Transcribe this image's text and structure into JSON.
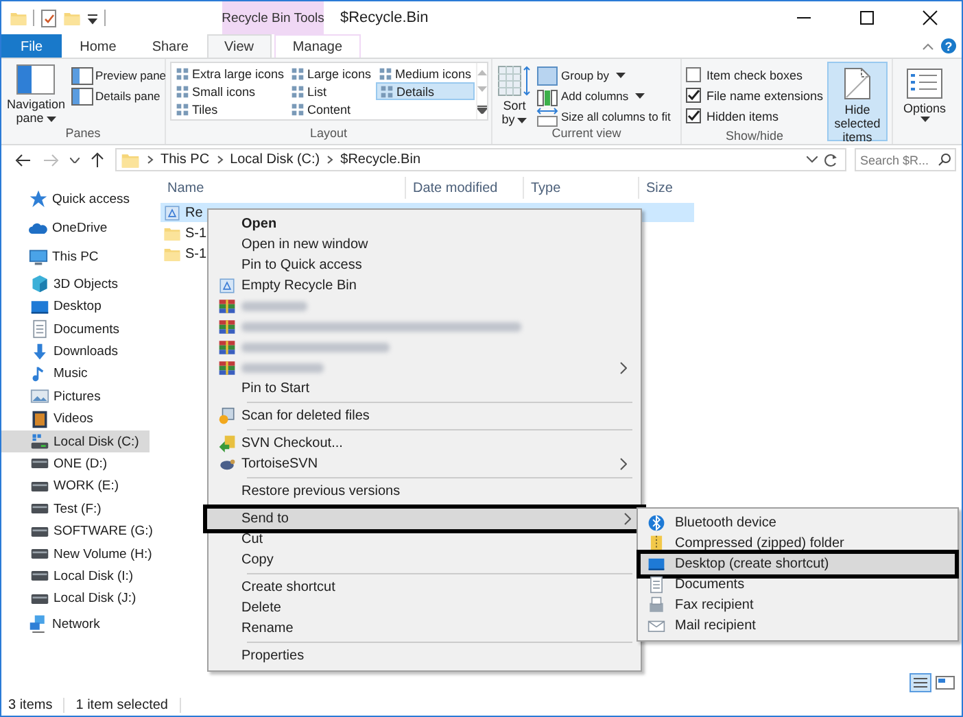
{
  "window": {
    "title": "$Recycle.Bin",
    "context_tab": "Recycle Bin Tools",
    "help_button": "?"
  },
  "tabs": [
    {
      "label": "File",
      "kind": "file",
      "selected": false
    },
    {
      "label": "Home",
      "kind": "tab",
      "selected": false
    },
    {
      "label": "Share",
      "kind": "tab",
      "selected": false
    },
    {
      "label": "View",
      "kind": "tab",
      "selected": true
    },
    {
      "label": "Manage",
      "kind": "context",
      "selected": false
    }
  ],
  "ribbon": {
    "panes": {
      "label": "Panes",
      "navigation_pane": "Navigation pane",
      "items": [
        "Preview pane",
        "Details pane"
      ]
    },
    "layout": {
      "label": "Layout",
      "items": [
        {
          "label": "Extra large icons",
          "selected": false
        },
        {
          "label": "Large icons",
          "selected": false
        },
        {
          "label": "Medium icons",
          "selected": false
        },
        {
          "label": "Small icons",
          "selected": false
        },
        {
          "label": "List",
          "selected": false
        },
        {
          "label": "Details",
          "selected": true
        },
        {
          "label": "Tiles",
          "selected": false
        },
        {
          "label": "Content",
          "selected": false
        }
      ]
    },
    "current_view": {
      "label": "Current view",
      "sort_by": "Sort by",
      "items": [
        "Group by",
        "Add columns",
        "Size all columns to fit"
      ]
    },
    "show_hide": {
      "label": "Show/hide",
      "checkboxes": [
        {
          "label": "Item check boxes",
          "checked": false
        },
        {
          "label": "File name extensions",
          "checked": true
        },
        {
          "label": "Hidden items",
          "checked": true
        }
      ],
      "hide_selected": "Hide selected items"
    },
    "options": {
      "label": "Options"
    }
  },
  "address": {
    "path": [
      "This PC",
      "Local Disk (C:)",
      "$Recycle.Bin"
    ],
    "search_placeholder": "Search $R..."
  },
  "sidebar": {
    "items": [
      {
        "label": "Quick access",
        "kind": "star",
        "selected": false
      },
      {
        "label": "OneDrive",
        "kind": "cloud",
        "selected": false
      },
      {
        "label": "This PC",
        "kind": "pc",
        "selected": false,
        "children": [
          {
            "label": "3D Objects",
            "kind": "cube",
            "selected": false
          },
          {
            "label": "Desktop",
            "kind": "desktop",
            "selected": false
          },
          {
            "label": "Documents",
            "kind": "doc",
            "selected": false
          },
          {
            "label": "Downloads",
            "kind": "download",
            "selected": false
          },
          {
            "label": "Music",
            "kind": "music",
            "selected": false
          },
          {
            "label": "Pictures",
            "kind": "pictures",
            "selected": false
          },
          {
            "label": "Videos",
            "kind": "videos",
            "selected": false
          },
          {
            "label": "Local Disk (C:)",
            "kind": "drive-os",
            "selected": true
          },
          {
            "label": "ONE (D:)",
            "kind": "drive",
            "selected": false
          },
          {
            "label": "WORK (E:)",
            "kind": "drive",
            "selected": false
          },
          {
            "label": "Test (F:)",
            "kind": "drive",
            "selected": false
          },
          {
            "label": "SOFTWARE (G:)",
            "kind": "drive",
            "selected": false
          },
          {
            "label": "New Volume (H:)",
            "kind": "drive",
            "selected": false
          },
          {
            "label": "Local Disk (I:)",
            "kind": "drive",
            "selected": false
          },
          {
            "label": "Local Disk (J:)",
            "kind": "drive",
            "selected": false
          }
        ]
      },
      {
        "label": "Network",
        "kind": "network",
        "selected": false
      }
    ]
  },
  "table": {
    "columns": [
      "Name",
      "Date modified",
      "Type",
      "Size"
    ],
    "rows": [
      {
        "name": "Re",
        "kind": "recycle",
        "selected": true
      },
      {
        "name": "S-1",
        "kind": "folder",
        "selected": false
      },
      {
        "name": "S-1",
        "kind": "folder",
        "selected": false
      }
    ]
  },
  "context_menu": {
    "items": [
      {
        "kind": "item",
        "label": "Open",
        "default": true,
        "submenu": false,
        "selected": false
      },
      {
        "kind": "item",
        "label": "Open in new window",
        "default": false,
        "submenu": false,
        "selected": false
      },
      {
        "kind": "item",
        "label": "Pin to Quick access",
        "default": false,
        "submenu": false,
        "selected": false
      },
      {
        "kind": "item",
        "label": "Empty Recycle Bin",
        "default": false,
        "submenu": false,
        "selected": false
      },
      {
        "kind": "blurred",
        "submenu": false
      },
      {
        "kind": "blurred",
        "submenu": false
      },
      {
        "kind": "blurred",
        "submenu": false
      },
      {
        "kind": "blurred",
        "submenu": true
      },
      {
        "kind": "item",
        "label": "Pin to Start",
        "default": false,
        "submenu": false,
        "selected": false
      },
      {
        "kind": "separator"
      },
      {
        "kind": "item",
        "label": "Scan for deleted files",
        "default": false,
        "submenu": false,
        "selected": false
      },
      {
        "kind": "separator"
      },
      {
        "kind": "item",
        "label": "SVN Checkout...",
        "default": false,
        "submenu": false,
        "selected": false
      },
      {
        "kind": "item",
        "label": "TortoiseSVN",
        "default": false,
        "submenu": true,
        "selected": false
      },
      {
        "kind": "separator"
      },
      {
        "kind": "item",
        "label": "Restore previous versions",
        "default": false,
        "submenu": false,
        "selected": false
      },
      {
        "kind": "separator"
      },
      {
        "kind": "item",
        "label": "Send to",
        "default": false,
        "submenu": true,
        "selected": true,
        "outlined": true
      },
      {
        "kind": "item",
        "label": "Cut",
        "default": false,
        "submenu": false,
        "selected": false
      },
      {
        "kind": "item",
        "label": "Copy",
        "default": false,
        "submenu": false,
        "selected": false
      },
      {
        "kind": "separator"
      },
      {
        "kind": "item",
        "label": "Create shortcut",
        "default": false,
        "submenu": false,
        "selected": false
      },
      {
        "kind": "item",
        "label": "Delete",
        "default": false,
        "submenu": false,
        "selected": false
      },
      {
        "kind": "item",
        "label": "Rename",
        "default": false,
        "submenu": false,
        "selected": false
      },
      {
        "kind": "separator"
      },
      {
        "kind": "item",
        "label": "Properties",
        "default": false,
        "submenu": false,
        "selected": false
      }
    ]
  },
  "send_to_menu": {
    "items": [
      {
        "label": "Bluetooth device",
        "selected": false
      },
      {
        "label": "Compressed (zipped) folder",
        "selected": false
      },
      {
        "label": "Desktop (create shortcut)",
        "selected": true,
        "outlined": true
      },
      {
        "label": "Documents",
        "selected": false
      },
      {
        "label": "Fax recipient",
        "selected": false
      },
      {
        "label": "Mail recipient",
        "selected": false
      }
    ]
  },
  "status_bar": [
    "3 items",
    "1 item selected"
  ]
}
